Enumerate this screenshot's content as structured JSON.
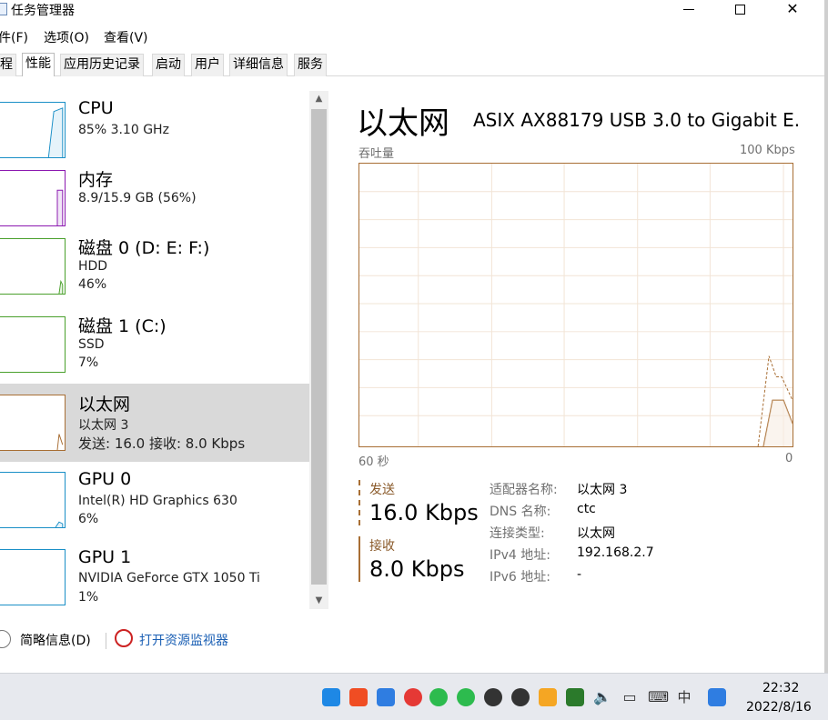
{
  "window": {
    "title": "任务管理器",
    "controls": {
      "minimize": "—",
      "close": "✕"
    }
  },
  "menu": [
    {
      "label": "件(F)"
    },
    {
      "label": "选项(O)"
    },
    {
      "label": "查看(V)"
    }
  ],
  "tabs": [
    {
      "label": "程",
      "active": false
    },
    {
      "label": "性能",
      "active": true
    },
    {
      "label": "应用历史记录",
      "active": false
    },
    {
      "label": "启动",
      "active": false
    },
    {
      "label": "用户",
      "active": false
    },
    {
      "label": "详细信息",
      "active": false
    },
    {
      "label": "服务",
      "active": false
    }
  ],
  "resources": [
    {
      "name": "CPU",
      "line1": "85% 3.10 GHz",
      "line2": "",
      "color": "#1a8fc7",
      "usage": 0.85
    },
    {
      "name": "内存",
      "line1": "8.9/15.9 GB (56%)",
      "line2": "",
      "color": "#8b18b0",
      "usage": 0.56
    },
    {
      "name": "磁盘 0 (D: E: F:)",
      "line1": "HDD",
      "line2": "46%",
      "color": "#4aa02c",
      "usage": 0.46
    },
    {
      "name": "磁盘 1 (C:)",
      "line1": "SSD",
      "line2": "7%",
      "color": "#4aa02c",
      "usage": 0.07
    },
    {
      "name": "以太网",
      "line1": "以太网 3",
      "line2": "发送: 16.0 接收: 8.0 Kbps",
      "color": "#a86e34",
      "usage": 0.16
    },
    {
      "name": "GPU 0",
      "line1": "Intel(R) HD Graphics 630",
      "line2": "6%",
      "color": "#1a8fc7",
      "usage": 0.06
    },
    {
      "name": "GPU 1",
      "line1": "NVIDIA GeForce GTX 1050 Ti",
      "line2": "1%",
      "color": "#1a8fc7",
      "usage": 0.01
    }
  ],
  "detail": {
    "title": "以太网",
    "adapter": "ASIX AX88179 USB 3.0 to Gigabit E...",
    "graph_label": "吞吐量",
    "graph_max": "100 Kbps",
    "axis_left": "60 秒",
    "axis_right": "0",
    "send_label": "发送",
    "send_value": "16.0 Kbps",
    "recv_label": "接收",
    "recv_value": "8.0 Kbps",
    "properties": [
      {
        "key": "适配器名称:",
        "value": "以太网 3"
      },
      {
        "key": "DNS 名称:",
        "value": "ctc"
      },
      {
        "key": "连接类型:",
        "value": "以太网"
      },
      {
        "key": "IPv4 地址:",
        "value": "192.168.2.7"
      },
      {
        "key": "IPv6 地址:",
        "value": "-"
      }
    ]
  },
  "footer": {
    "fewer_details": "简略信息(D)",
    "open_monitor": "打开资源监视器"
  },
  "taskbar": {
    "time": "22:32",
    "date": "2022/8/16",
    "ime": "中",
    "tray_icons": [
      "pin-app",
      "app-orange",
      "app-blue",
      "netease-music",
      "wechat",
      "wechat-alt",
      "qq",
      "qq-alt",
      "shield",
      "security-center",
      "volume",
      "network",
      "keyboard",
      "ime",
      "search-app"
    ]
  }
}
